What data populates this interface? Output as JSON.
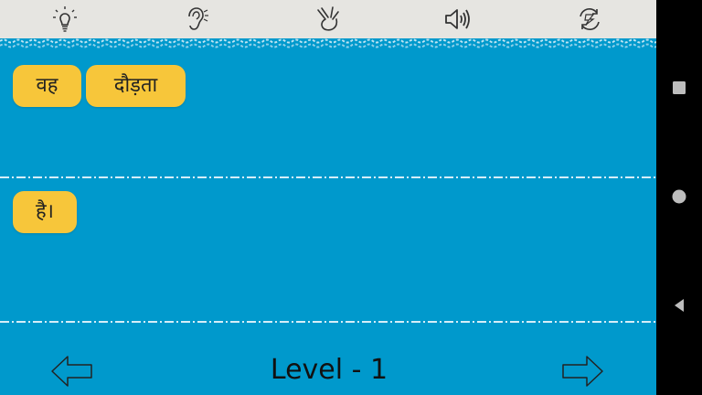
{
  "toolbar": {
    "icons": [
      "lightbulb-icon",
      "ear-icon",
      "sign-hand-icon",
      "speaker-icon",
      "refresh-icon"
    ]
  },
  "rows": [
    {
      "words": [
        "वह",
        "दौड़ता"
      ]
    },
    {
      "words": [
        "है।"
      ]
    }
  ],
  "footer": {
    "level_label": "Level - 1"
  },
  "colors": {
    "background": "#0099cc",
    "toolbar": "#e6e5e1",
    "chip": "#f7c63a",
    "navbar": "#000000"
  }
}
